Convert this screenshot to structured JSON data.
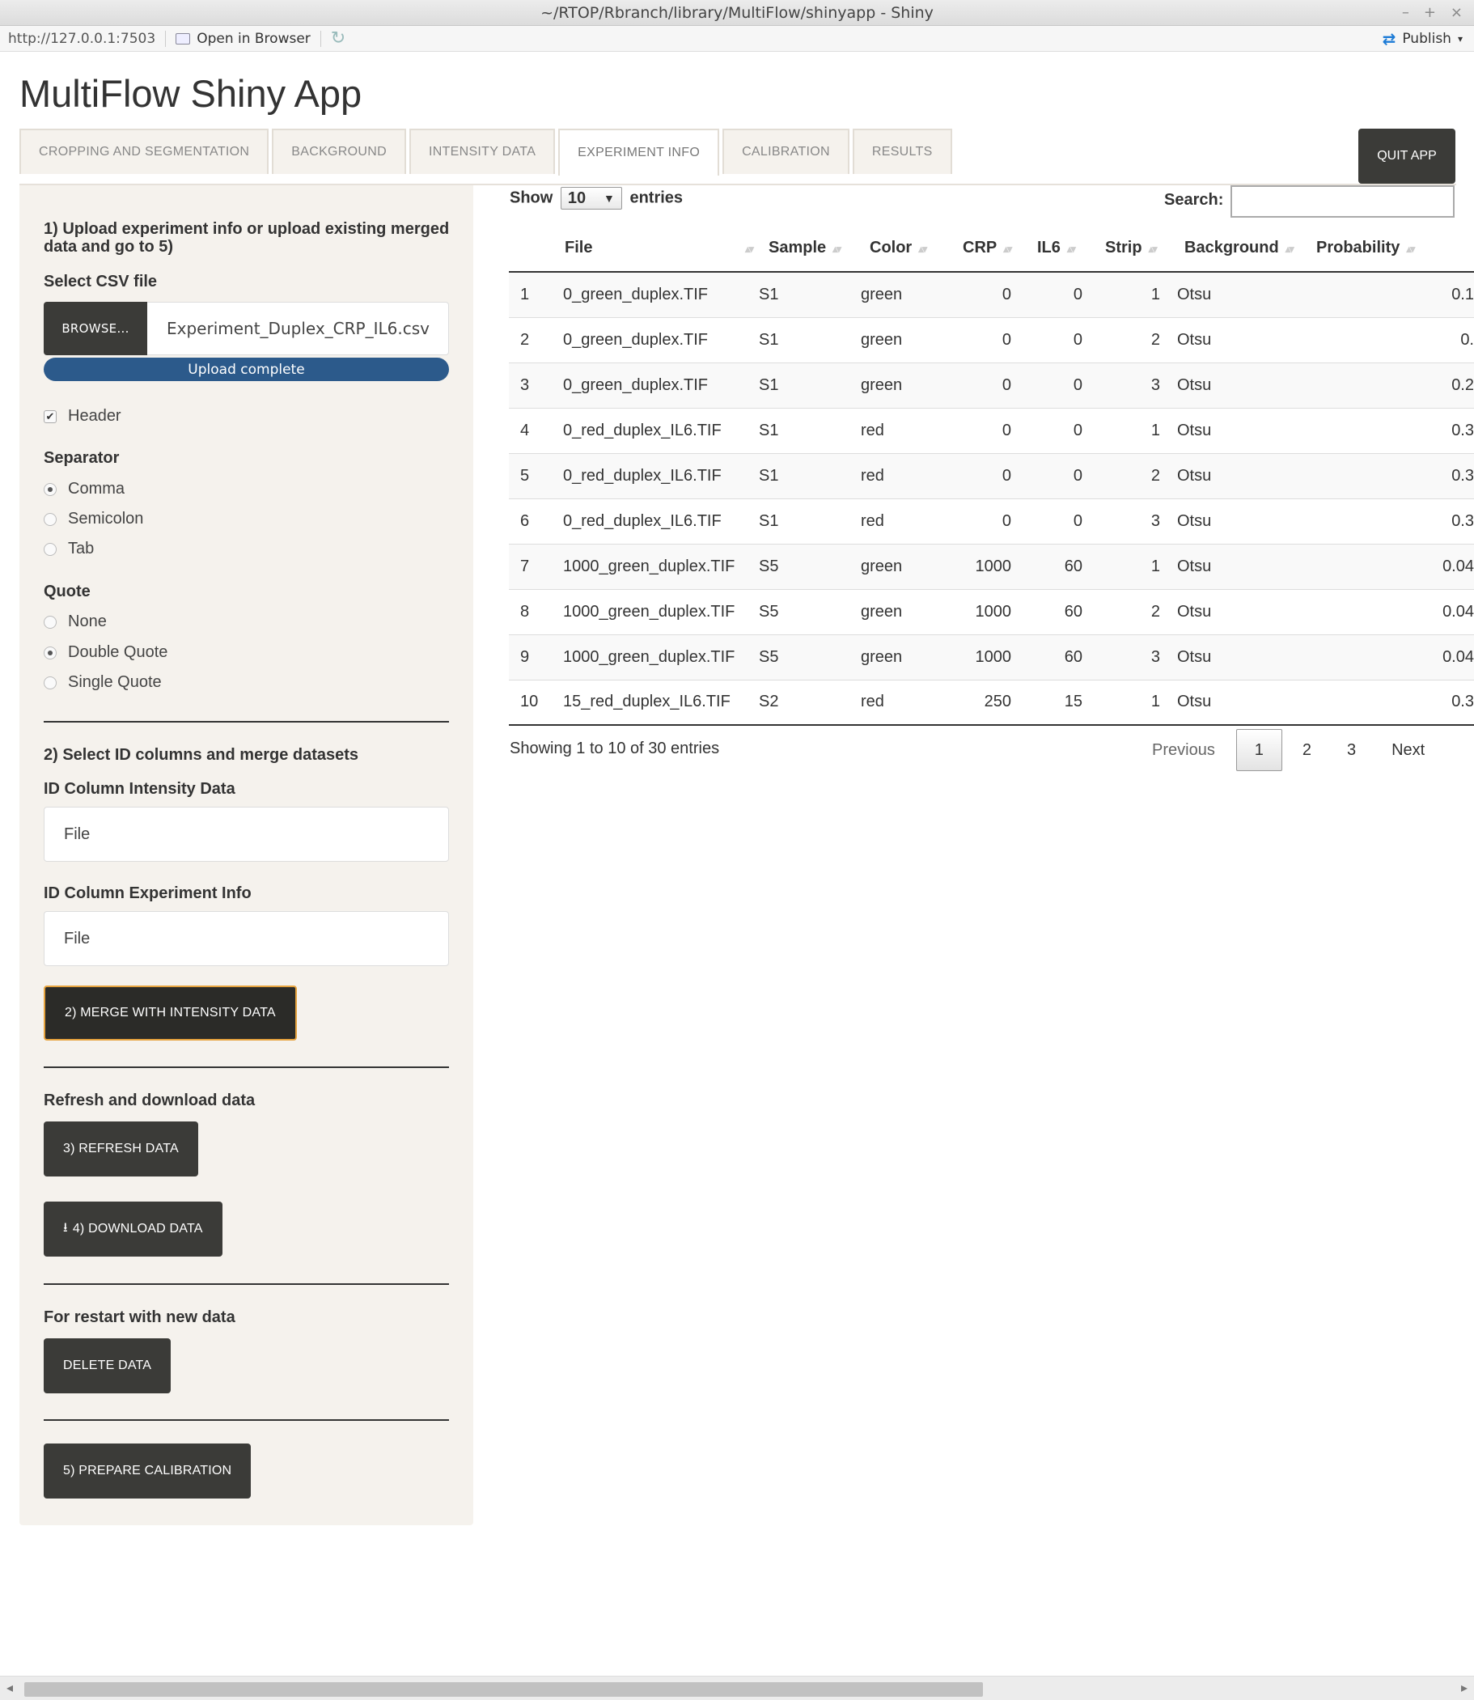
{
  "window": {
    "title": "~/RTOP/Rbranch/library/MultiFlow/shinyapp - Shiny",
    "controls": [
      "–",
      "+",
      "×"
    ]
  },
  "address": {
    "url": "http://127.0.0.1:7503",
    "open_in_browser": "Open in Browser",
    "publish": "Publish"
  },
  "app": {
    "title": "MultiFlow Shiny App",
    "quit": "QUIT APP"
  },
  "tabs": [
    {
      "label": "CROPPING AND SEGMENTATION"
    },
    {
      "label": "BACKGROUND"
    },
    {
      "label": "INTENSITY DATA"
    },
    {
      "label": "EXPERIMENT INFO",
      "active": true
    },
    {
      "label": "CALIBRATION"
    },
    {
      "label": "RESULTS"
    }
  ],
  "sidebar": {
    "upload_heading": "1) Upload experiment info or upload existing merged data and go to 5)",
    "select_csv_label": "Select CSV file",
    "browse_label": "BROWSE...",
    "file_name": "Experiment_Duplex_CRP_IL6.csv",
    "upload_status": "Upload complete",
    "header_label": "Header",
    "header_checked": true,
    "separator_label": "Separator",
    "separator_options": [
      "Comma",
      "Semicolon",
      "Tab"
    ],
    "separator_selected": "Comma",
    "quote_label": "Quote",
    "quote_options": [
      "None",
      "Double Quote",
      "Single Quote"
    ],
    "quote_selected": "Double Quote",
    "merge_heading": "2) Select ID columns and merge datasets",
    "id_intensity_label": "ID Column Intensity Data",
    "id_intensity_value": "File",
    "id_experiment_label": "ID Column Experiment Info",
    "id_experiment_value": "File",
    "merge_button": "2) MERGE WITH INTENSITY DATA",
    "refresh_heading": "Refresh and download data",
    "refresh_button": "3) REFRESH DATA",
    "download_button": "4) DOWNLOAD DATA",
    "restart_heading": "For restart with new data",
    "delete_button": "DELETE DATA",
    "prepare_button": "5) PREPARE CALIBRATION"
  },
  "table": {
    "show_label": "Show",
    "page_length": "10",
    "entries_label": "entries",
    "search_label": "Search:",
    "columns": [
      "",
      "File",
      "Sample",
      "Color",
      "CRP",
      "IL6",
      "Strip",
      "Background",
      "Probability"
    ],
    "rows": [
      [
        "1",
        "0_green_duplex.TIF",
        "S1",
        "green",
        "0",
        "0",
        "1",
        "Otsu",
        "0.1"
      ],
      [
        "2",
        "0_green_duplex.TIF",
        "S1",
        "green",
        "0",
        "0",
        "2",
        "Otsu",
        "0."
      ],
      [
        "3",
        "0_green_duplex.TIF",
        "S1",
        "green",
        "0",
        "0",
        "3",
        "Otsu",
        "0.2"
      ],
      [
        "4",
        "0_red_duplex_IL6.TIF",
        "S1",
        "red",
        "0",
        "0",
        "1",
        "Otsu",
        "0.3"
      ],
      [
        "5",
        "0_red_duplex_IL6.TIF",
        "S1",
        "red",
        "0",
        "0",
        "2",
        "Otsu",
        "0.3"
      ],
      [
        "6",
        "0_red_duplex_IL6.TIF",
        "S1",
        "red",
        "0",
        "0",
        "3",
        "Otsu",
        "0.3"
      ],
      [
        "7",
        "1000_green_duplex.TIF",
        "S5",
        "green",
        "1000",
        "60",
        "1",
        "Otsu",
        "0.04"
      ],
      [
        "8",
        "1000_green_duplex.TIF",
        "S5",
        "green",
        "1000",
        "60",
        "2",
        "Otsu",
        "0.04"
      ],
      [
        "9",
        "1000_green_duplex.TIF",
        "S5",
        "green",
        "1000",
        "60",
        "3",
        "Otsu",
        "0.04"
      ],
      [
        "10",
        "15_red_duplex_IL6.TIF",
        "S2",
        "red",
        "250",
        "15",
        "1",
        "Otsu",
        "0.3"
      ]
    ],
    "info": "Showing 1 to 10 of 30 entries",
    "pagination": {
      "previous": "Previous",
      "pages": [
        "1",
        "2",
        "3"
      ],
      "current": "1",
      "next": "Next"
    }
  },
  "colors": {
    "dark_button": "#3b3b38",
    "sidebar_bg": "#f5f2ed",
    "progress": "#2c5a8b",
    "focus_ring": "#e6a33e"
  }
}
